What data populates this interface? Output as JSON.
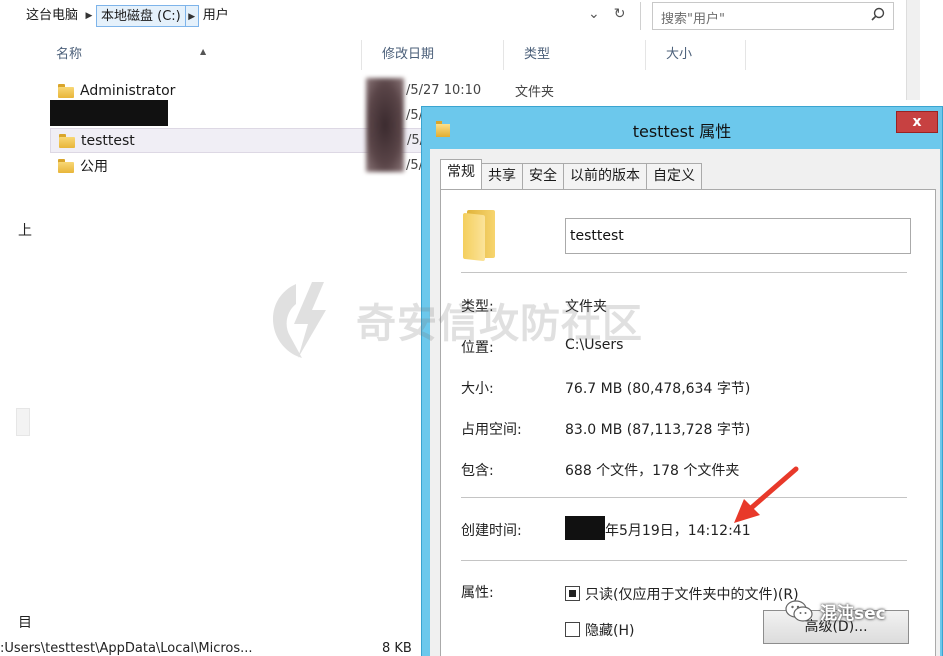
{
  "explorer": {
    "breadcrumb": [
      "这台电脑",
      "本地磁盘 (C:)",
      "用户"
    ],
    "search_placeholder": "搜索\"用户\"",
    "columns": [
      "名称",
      "修改日期",
      "类型",
      "大小"
    ],
    "rows": [
      {
        "name": "Administrator",
        "date": "/5/27 10:10",
        "type": "文件夹"
      },
      {
        "name": "",
        "date": "/5/",
        "type": ""
      },
      {
        "name": "testtest",
        "date": "/5/",
        "type": ""
      },
      {
        "name": "公用",
        "date": "/5/",
        "type": ""
      }
    ],
    "left_fragment_top": "上",
    "left_fragment_bottom": "目",
    "status_path": ":Users\\testtest\\AppData\\Local\\Micros...",
    "status_size": "8 KB"
  },
  "dialog": {
    "title": "testtest 属性",
    "close_label": "x",
    "tabs": [
      "常规",
      "共享",
      "安全",
      "以前的版本",
      "自定义"
    ],
    "active_tab": 0,
    "folder_name": "testtest",
    "props": {
      "type_label": "类型:",
      "type_value": "文件夹",
      "location_label": "位置:",
      "location_value": "C:\\Users",
      "size_label": "大小:",
      "size_value": "76.7 MB (80,478,634 字节)",
      "disk_size_label": "占用空间:",
      "disk_size_value": "83.0 MB (87,113,728 字节)",
      "contains_label": "包含:",
      "contains_value": "688 个文件，178 个文件夹",
      "created_label": "创建时间:",
      "created_value": "年5月19日，14:12:41",
      "attributes_label": "属性:",
      "readonly_label": "只读(仅应用于文件夹中的文件)(R)",
      "hidden_label": "隐藏(H)",
      "advanced_label": "高级(D)..."
    }
  },
  "watermark": {
    "center_text": "奇安信攻防社区",
    "corner_text": "混沌sec"
  },
  "colors": {
    "dialog_frame": "#6cc8ec",
    "close_button": "#c74141",
    "arrow": "#e8392a"
  },
  "icons": [
    "folder-icon",
    "search-icon",
    "chevron-down-icon",
    "refresh-icon",
    "close-icon",
    "wechat-icon",
    "bolt-logo-icon"
  ]
}
